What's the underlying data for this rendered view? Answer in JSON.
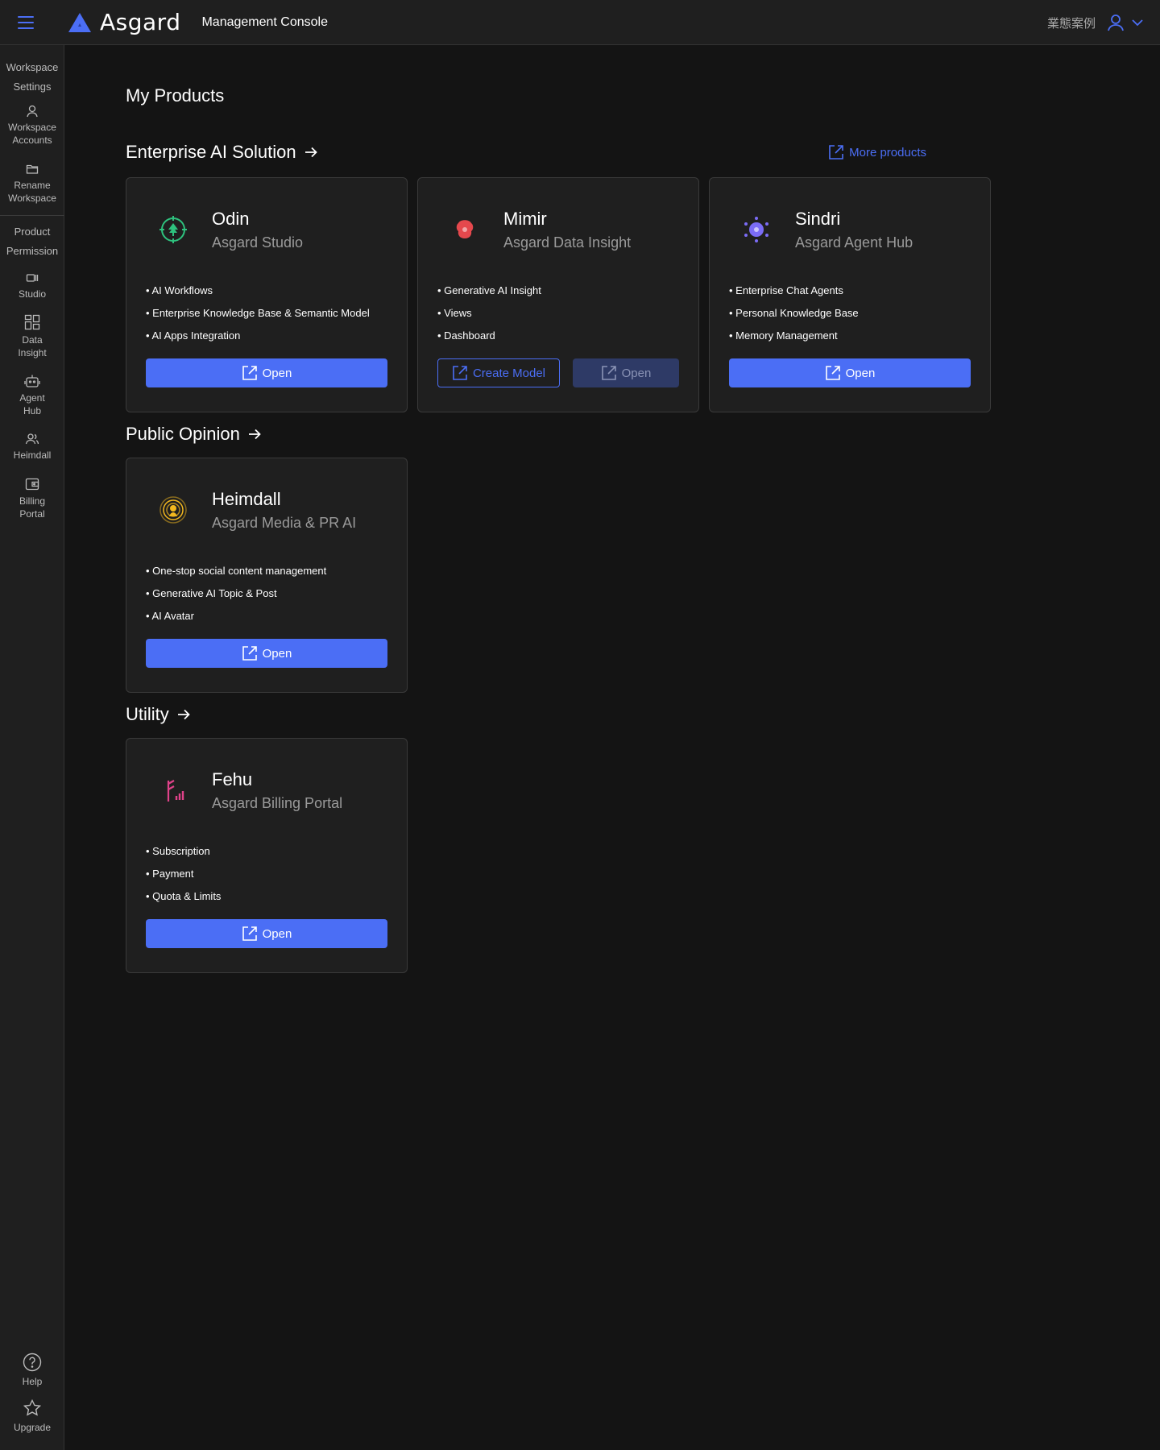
{
  "header": {
    "app_name": "Asgard",
    "console_title": "Management Console",
    "case_link": "業態案例"
  },
  "sidebar": {
    "workspace_settings_label_line1": "Workspace",
    "workspace_settings_label_line2": "Settings",
    "items_workspace": [
      {
        "line1": "Workspace",
        "line2": "Accounts",
        "icon": "user-icon"
      },
      {
        "line1": "Rename",
        "line2": "Workspace",
        "icon": "folder-icon"
      }
    ],
    "product_permission_line1": "Product",
    "product_permission_line2": "Permission",
    "items_product": [
      {
        "line1": "Studio",
        "line2": "",
        "icon": "studio-icon"
      },
      {
        "line1": "Data",
        "line2": "Insight",
        "icon": "dashboard-icon"
      },
      {
        "line1": "Agent",
        "line2": "Hub",
        "icon": "robot-icon"
      },
      {
        "line1": "Heimdall",
        "line2": "",
        "icon": "people-icon"
      },
      {
        "line1": "Billing",
        "line2": "Portal",
        "icon": "wallet-icon"
      }
    ],
    "help_label": "Help",
    "upgrade_label": "Upgrade"
  },
  "main": {
    "page_title": "My Products",
    "more_products": "More products",
    "sections": [
      {
        "title": "Enterprise AI Solution"
      },
      {
        "title": "Public Opinion"
      },
      {
        "title": "Utility"
      }
    ],
    "cards": [
      {
        "name": "Odin",
        "subtitle": "Asgard Studio",
        "features": [
          "AI Workflows",
          "Enterprise Knowledge Base & Semantic Model",
          "AI Apps Integration"
        ],
        "open_label": "Open",
        "logo_color": "#2ec27e"
      },
      {
        "name": "Mimir",
        "subtitle": "Asgard Data Insight",
        "features": [
          "Generative AI Insight",
          "Views",
          "Dashboard"
        ],
        "create_label": "Create Model",
        "open_label": "Open",
        "logo_color": "#e5484d"
      },
      {
        "name": "Sindri",
        "subtitle": "Asgard Agent Hub",
        "features": [
          "Enterprise Chat Agents",
          "Personal Knowledge Base",
          "Memory Management"
        ],
        "open_label": "Open",
        "logo_color": "#7b6cf6"
      },
      {
        "name": "Heimdall",
        "subtitle": "Asgard Media & PR AI",
        "features": [
          "One-stop social content management",
          "Generative AI Topic & Post",
          "AI Avatar"
        ],
        "open_label": "Open",
        "logo_color": "#f2b81f"
      },
      {
        "name": "Fehu",
        "subtitle": "Asgard Billing Portal",
        "features": [
          "Subscription",
          "Payment",
          "Quota & Limits"
        ],
        "open_label": "Open",
        "logo_color": "#e0428a"
      }
    ]
  },
  "colors": {
    "accent": "#4b6ef5",
    "background": "#141414",
    "panel": "#1f1f1f"
  }
}
